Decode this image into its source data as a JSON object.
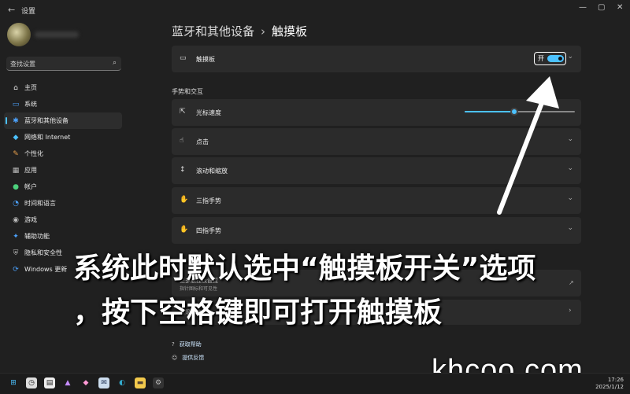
{
  "window": {
    "title": "设置",
    "back_glyph": "←",
    "controls": [
      "—",
      "▢",
      "✕"
    ]
  },
  "sidebar": {
    "search_placeholder": "查找设置",
    "items": [
      {
        "label": "主页",
        "icon": "home-icon",
        "glyph": "⌂",
        "color": "#e8e8e8"
      },
      {
        "label": "系统",
        "icon": "monitor-icon",
        "glyph": "▭",
        "color": "#4ca3ff"
      },
      {
        "label": "蓝牙和其他设备",
        "icon": "bluetooth-icon",
        "glyph": "✱",
        "color": "#4ca3ff"
      },
      {
        "label": "网络和 Internet",
        "icon": "wifi-icon",
        "glyph": "◆",
        "color": "#4cc2ff"
      },
      {
        "label": "个性化",
        "icon": "brush-icon",
        "glyph": "✎",
        "color": "#e8a04c"
      },
      {
        "label": "应用",
        "icon": "apps-icon",
        "glyph": "▦",
        "color": "#bbbbbb"
      },
      {
        "label": "帐户",
        "icon": "account-icon",
        "glyph": "●",
        "color": "#4cd07c"
      },
      {
        "label": "时间和语言",
        "icon": "clock-globe-icon",
        "glyph": "◔",
        "color": "#4ca3ff"
      },
      {
        "label": "游戏",
        "icon": "gamepad-icon",
        "glyph": "◉",
        "color": "#bbbbbb"
      },
      {
        "label": "辅助功能",
        "icon": "accessibility-icon",
        "glyph": "✦",
        "color": "#4ca3ff"
      },
      {
        "label": "隐私和安全性",
        "icon": "shield-icon",
        "glyph": "⛨",
        "color": "#bbbbbb"
      },
      {
        "label": "Windows 更新",
        "icon": "update-icon",
        "glyph": "⟳",
        "color": "#4ca3ff"
      }
    ],
    "active_index": 2
  },
  "breadcrumb": {
    "parent": "蓝牙和其他设备",
    "separator": "›",
    "current": "触摸板"
  },
  "touchpad_toggle": {
    "label": "触摸板",
    "state_text": "开",
    "on": true
  },
  "gestures_section_title": "手势和交互",
  "cursor_speed": {
    "label": "光标速度",
    "value": 0.45
  },
  "expanders": [
    {
      "label": "点击",
      "icon": "tap-icon",
      "glyph": "☝"
    },
    {
      "label": "滚动和缩放",
      "icon": "scroll-icon",
      "glyph": "↕"
    },
    {
      "label": "三指手势",
      "icon": "three-finger-icon",
      "glyph": "✋"
    },
    {
      "label": "四指手势",
      "icon": "four-finger-icon",
      "glyph": "✋"
    }
  ],
  "more_settings": {
    "label": "更多触控板设置",
    "sub": "指针图标和可见性"
  },
  "advanced": {
    "label": "高级手势"
  },
  "links": [
    "获取帮助",
    "提供反馈"
  ],
  "caption": {
    "line1": "系统此时默认选中“触摸板开关”选项",
    "line2": "，按下空格键即可打开触摸板"
  },
  "watermark": "khcoo.com",
  "clock": {
    "time": "17:26",
    "date": "2025/1/12"
  },
  "accent_color": "#4cc2ff"
}
